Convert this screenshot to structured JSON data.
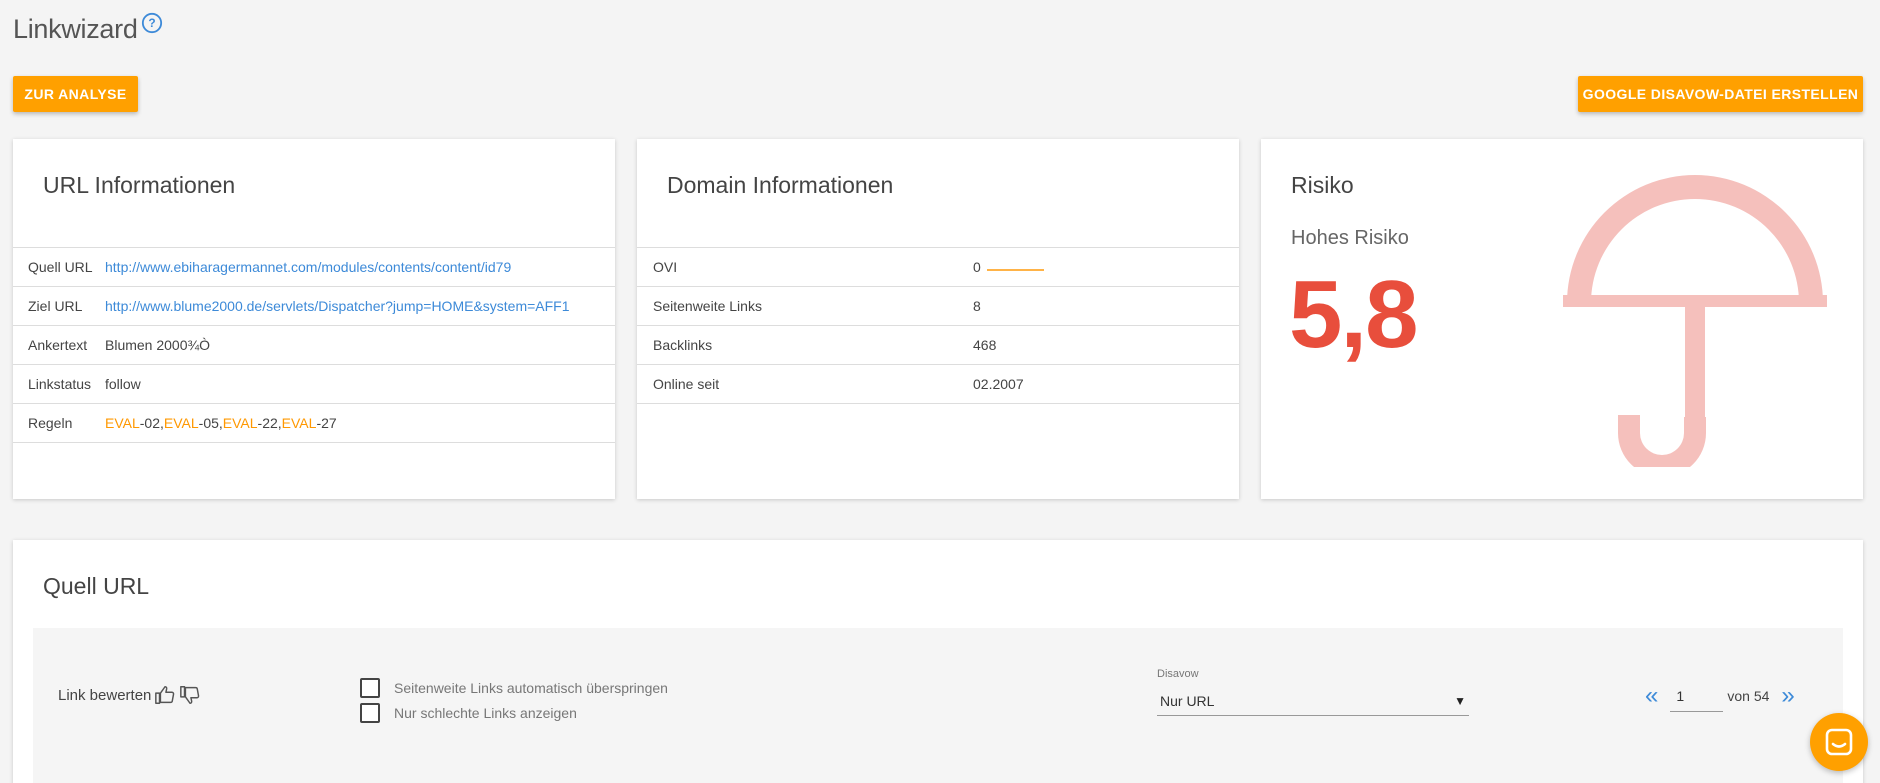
{
  "header": {
    "title": "Linkwizard",
    "analyse_button": "ZUR ANALYSE",
    "disavow_button": "GOOGLE DISAVOW-DATEI ERSTELLEN"
  },
  "url_info": {
    "title": "URL Informationen",
    "rows": [
      {
        "label": "Quell URL",
        "value": "http://www.ebiharagermannet.com/modules/contents/content/id79"
      },
      {
        "label": "Ziel URL",
        "value": "http://www.blume2000.de/servlets/Dispatcher?jump=HOME&system=AFF1"
      },
      {
        "label": "Ankertext",
        "value": "Blumen 2000¾Ò"
      },
      {
        "label": "Linkstatus",
        "value": "follow"
      },
      {
        "label": "Regeln",
        "rules": [
          {
            "prefix": "EVAL",
            "suffix": "-02,"
          },
          {
            "prefix": "EVAL",
            "suffix": "-05,"
          },
          {
            "prefix": "EVAL",
            "suffix": "-22,"
          },
          {
            "prefix": "EVAL",
            "suffix": "-27"
          }
        ]
      }
    ]
  },
  "domain_info": {
    "title": "Domain Informationen",
    "rows": [
      {
        "label": "OVI",
        "value": "0"
      },
      {
        "label": "Seitenweite Links",
        "value": "8"
      },
      {
        "label": "Backlinks",
        "value": "468"
      },
      {
        "label": "Online seit",
        "value": "02.2007"
      }
    ]
  },
  "risk": {
    "title": "Risiko",
    "level": "Hohes Risiko",
    "score": "5,8",
    "score_color": "#e84e3c",
    "icon": "umbrella-icon"
  },
  "quell": {
    "title": "Quell URL",
    "rate_label": "Link bewerten",
    "checkbox_skip": "Seitenweite Links automatisch überspringen",
    "checkbox_bad": "Nur schlechte Links anzeigen",
    "select_label": "Disavow",
    "select_value": "Nur URL",
    "page_current": "1",
    "page_total_text": "von 54"
  },
  "colors": {
    "accent": "#ffa000",
    "link": "#3d8ad8",
    "rule": "#ff9800"
  }
}
